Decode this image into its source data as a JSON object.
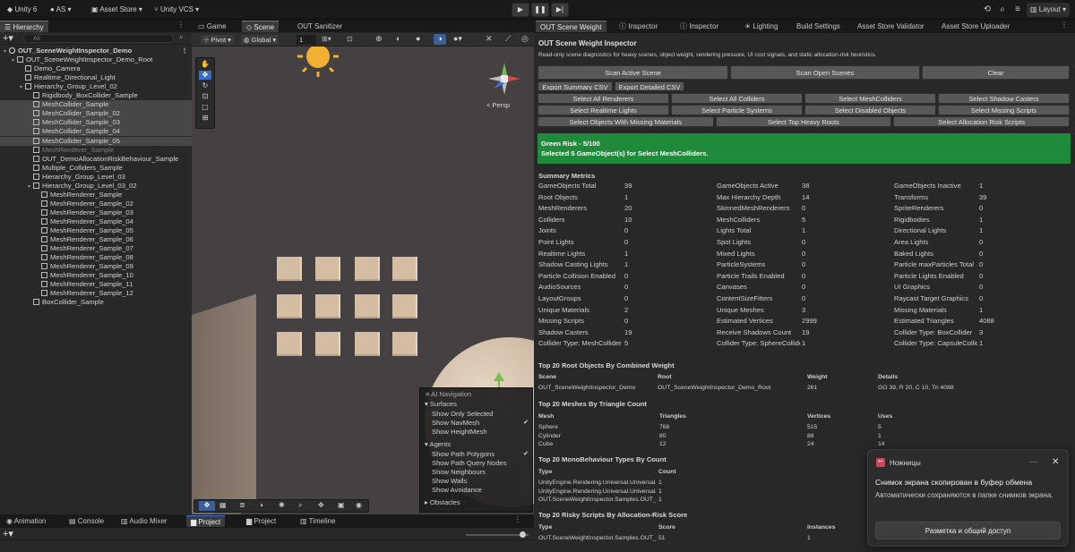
{
  "toolbar": {
    "app": "Unity 6",
    "account": "AS",
    "asset_store": "Asset Store",
    "vcs": "Unity VCS",
    "layout": "Layout"
  },
  "hierarchy": {
    "tab": "Hierarchy",
    "search_placeholder": "All",
    "rows": [
      {
        "label": "OUT_SceneWeightInspector_Demo",
        "indent": 0,
        "kind": "scene",
        "state": "bold"
      },
      {
        "label": "OUT_SceneWeightInspector_Demo_Root",
        "indent": 1,
        "kind": "go",
        "state": "normal"
      },
      {
        "label": "Demo_Camera",
        "indent": 2,
        "kind": "go",
        "state": "normal"
      },
      {
        "label": "Realtime_Directional_Light",
        "indent": 2,
        "kind": "go",
        "state": "normal"
      },
      {
        "label": "Hierarchy_Group_Level_02",
        "indent": 2,
        "kind": "go",
        "state": "normal"
      },
      {
        "label": "Rigidbody_BoxCollider_Sample",
        "indent": 3,
        "kind": "go",
        "state": "normal"
      },
      {
        "label": "MeshCollider_Sample",
        "indent": 3,
        "kind": "go",
        "state": "sel"
      },
      {
        "label": "MeshCollider_Sample_02",
        "indent": 3,
        "kind": "go",
        "state": "sel"
      },
      {
        "label": "MeshCollider_Sample_03",
        "indent": 3,
        "kind": "go",
        "state": "sel"
      },
      {
        "label": "MeshCollider_Sample_04",
        "indent": 3,
        "kind": "go",
        "state": "sel"
      },
      {
        "label": "MeshCollider_Sample_05",
        "indent": 3,
        "kind": "go",
        "state": "sel"
      },
      {
        "label": "MeshRenderer_Sample",
        "indent": 3,
        "kind": "go",
        "state": "dim"
      },
      {
        "label": "OUT_DemoAllocationRiskBehaviour_Sample",
        "indent": 3,
        "kind": "go",
        "state": "normal"
      },
      {
        "label": "Multiple_Colliders_Sample",
        "indent": 3,
        "kind": "go",
        "state": "normal"
      },
      {
        "label": "Hierarchy_Group_Level_03",
        "indent": 3,
        "kind": "go",
        "state": "normal"
      },
      {
        "label": "Hierarchy_Group_Level_03_02",
        "indent": 3,
        "kind": "go",
        "state": "normal"
      },
      {
        "label": "MeshRenderer_Sample",
        "indent": 4,
        "kind": "go",
        "state": "normal"
      },
      {
        "label": "MeshRenderer_Sample_02",
        "indent": 4,
        "kind": "go",
        "state": "normal"
      },
      {
        "label": "MeshRenderer_Sample_03",
        "indent": 4,
        "kind": "go",
        "state": "normal"
      },
      {
        "label": "MeshRenderer_Sample_04",
        "indent": 4,
        "kind": "go",
        "state": "normal"
      },
      {
        "label": "MeshRenderer_Sample_05",
        "indent": 4,
        "kind": "go",
        "state": "normal"
      },
      {
        "label": "MeshRenderer_Sample_06",
        "indent": 4,
        "kind": "go",
        "state": "normal"
      },
      {
        "label": "MeshRenderer_Sample_07",
        "indent": 4,
        "kind": "go",
        "state": "normal"
      },
      {
        "label": "MeshRenderer_Sample_08",
        "indent": 4,
        "kind": "go",
        "state": "normal"
      },
      {
        "label": "MeshRenderer_Sample_09",
        "indent": 4,
        "kind": "go",
        "state": "normal"
      },
      {
        "label": "MeshRenderer_Sample_10",
        "indent": 4,
        "kind": "go",
        "state": "normal"
      },
      {
        "label": "MeshRenderer_Sample_11",
        "indent": 4,
        "kind": "go",
        "state": "normal"
      },
      {
        "label": "MeshRenderer_Sample_12",
        "indent": 4,
        "kind": "go",
        "state": "normal"
      },
      {
        "label": "BoxCollider_Sample",
        "indent": 3,
        "kind": "go",
        "state": "normal"
      }
    ]
  },
  "scene": {
    "tabs": [
      "Game",
      "Scene",
      "OUT Sanitizer"
    ],
    "pivot": "Pivot",
    "global": "Global",
    "grid_value": "1",
    "persp": "< Persp"
  },
  "ai_nav": {
    "title": "AI Navigation",
    "surfaces": "Surfaces",
    "surface_items": [
      {
        "label": "Show Only Selected",
        "checked": false
      },
      {
        "label": "Show NavMesh",
        "checked": true
      },
      {
        "label": "Show HeightMesh",
        "checked": false
      }
    ],
    "agents": "Agents",
    "agent_items": [
      {
        "label": "Show Path Polygons",
        "checked": true
      },
      {
        "label": "Show Path Query Nodes",
        "checked": false
      },
      {
        "label": "Show Neighbours",
        "checked": false
      },
      {
        "label": "Show Walls",
        "checked": false
      },
      {
        "label": "Show Avoidance",
        "checked": false
      }
    ],
    "obstacles": "Obstacles"
  },
  "bottom": {
    "tabs": [
      "Animation",
      "Console",
      "Audio Mixer",
      "Project",
      "Project",
      "Timeline"
    ]
  },
  "inspector": {
    "tabs": [
      "OUT Scene Weight",
      "Inspector",
      "Inspector",
      "Lighting",
      "Build Settings",
      "Asset Store Validator",
      "Asset Store Uploader"
    ],
    "title": "OUT Scene Weight Inspector",
    "subtitle": "Read-only scene diagnostics for heavy scenes, object weight, rendering pressure, UI cost signals, and static allocation-risk heuristics.",
    "scan_active": "Scan Active Scene",
    "scan_open": "Scan Open Scenes",
    "clear": "Clear",
    "export_summary": "Export Summary CSV",
    "export_detailed": "Export Detailed CSV",
    "select_row1": [
      "Select All Renderers",
      "Select All Colliders",
      "Select MeshColliders",
      "Select Shadow Casters"
    ],
    "select_row2": [
      "Select Realtime Lights",
      "Select Particle Systems",
      "Select Disabled Objects",
      "Select Missing Scripts"
    ],
    "select_row3": [
      "Select Objects With Missing Materials",
      "Select Top Heavy Roots",
      "Select Allocation Risk Scripts"
    ],
    "risk_title": "Green Risk - 5/100",
    "risk_message": "Selected 5 GameObject(s) for Select MeshColliders.",
    "risk_color": "#1f8a3a",
    "summary_title": "Summary Metrics",
    "metrics_col1": [
      [
        "GameObjects Total",
        "39"
      ],
      [
        "Root Objects",
        "1"
      ],
      [
        "MeshRenderers",
        "20"
      ],
      [
        "Colliders",
        "10"
      ],
      [
        "Joints",
        "0"
      ],
      [
        "Point Lights",
        "0"
      ],
      [
        "Realtime Lights",
        "1"
      ],
      [
        "Shadow Casting Lights",
        "1"
      ],
      [
        "Particle Collision Enabled",
        "0"
      ],
      [
        "AudioSources",
        "0"
      ],
      [
        "LayoutGroups",
        "0"
      ],
      [
        "Unique Materials",
        "2"
      ],
      [
        "Missing Scripts",
        "0"
      ],
      [
        "Shadow Casters",
        "19"
      ],
      [
        "Collider Type: MeshCollider",
        "5"
      ]
    ],
    "metrics_col2": [
      [
        "GameObjects Active",
        "38"
      ],
      [
        "Max Hierarchy Depth",
        "14"
      ],
      [
        "SkinnedMeshRenderers",
        "0"
      ],
      [
        "MeshColliders",
        "5"
      ],
      [
        "Lights Total",
        "1"
      ],
      [
        "Spot Lights",
        "0"
      ],
      [
        "Mixed Lights",
        "0"
      ],
      [
        "ParticleSystems",
        "0"
      ],
      [
        "Particle Trails Enabled",
        "0"
      ],
      [
        "Canvases",
        "0"
      ],
      [
        "ContentSizeFitters",
        "0"
      ],
      [
        "Unique Meshes",
        "3"
      ],
      [
        "Estimated Vertices",
        "2999"
      ],
      [
        "Receive Shadows Count",
        "19"
      ],
      [
        "Collider Type: SphereCollider",
        "1"
      ]
    ],
    "metrics_col3": [
      [
        "GameObjects Inactive",
        "1"
      ],
      [
        "Transforms",
        "39"
      ],
      [
        "SpriteRenderers",
        "0"
      ],
      [
        "Rigidbodies",
        "1"
      ],
      [
        "Directional Lights",
        "1"
      ],
      [
        "Area Lights",
        "0"
      ],
      [
        "Baked Lights",
        "0"
      ],
      [
        "Particle maxParticles Total",
        "0"
      ],
      [
        "Particle Lights Enabled",
        "0"
      ],
      [
        "UI Graphics",
        "0"
      ],
      [
        "Raycast Target Graphics",
        "0"
      ],
      [
        "Missing Materials",
        "1"
      ],
      [
        "Estimated Triangles",
        "4088"
      ],
      [
        "Collider Type: BoxCollider",
        "3"
      ],
      [
        "Collider Type: CapsuleCollider",
        "1"
      ]
    ],
    "roots_title": "Top 20 Root Objects By Combined Weight",
    "roots_headers": [
      "Scene",
      "Root",
      "Weight",
      "Details"
    ],
    "roots_rows": [
      [
        "OUT_SceneWeightInspector_Demo",
        "OUT_SceneWeightInspector_Demo_Root",
        "261",
        "GO 39, R 20, C 10, Tri 4088"
      ]
    ],
    "meshes_title": "Top 20 Meshes By Triangle Count",
    "meshes_headers": [
      "Mesh",
      "Triangles",
      "Vertices",
      "Uses"
    ],
    "meshes_rows": [
      [
        "Sphere",
        "768",
        "515",
        "5"
      ],
      [
        "Cylinder",
        "80",
        "88",
        "1"
      ],
      [
        "Cube",
        "12",
        "24",
        "14"
      ]
    ],
    "mono_title": "Top 20 MonoBehaviour Types By Count",
    "mono_headers": [
      "Type",
      "Count"
    ],
    "mono_rows": [
      [
        "UnityEngine.Rendering.Universal.UniversalAdditionalCameraData",
        "1"
      ],
      [
        "UnityEngine.Rendering.Universal.UniversalAdditionalLightData",
        "1"
      ],
      [
        "OUT.SceneWeightInspector.Samples.OUT_DemoAllocationRiskBehaviour",
        "1"
      ]
    ],
    "risky_title": "Top 20 Risky Scripts By Allocation-Risk Score",
    "risky_headers": [
      "Type",
      "Score",
      "Instances"
    ],
    "risky_rows": [
      [
        "OUT.SceneWeightInspector.Samples.OUT_DemoAllocationRiskBehaviour",
        "51",
        "1"
      ]
    ]
  },
  "toast": {
    "app": "Ножницы",
    "title": "Снимок экрана скопирован в буфер обмена",
    "body": "Автоматически сохраняются в папке снимков экрана.",
    "button": "Разметка и общий доступ"
  }
}
